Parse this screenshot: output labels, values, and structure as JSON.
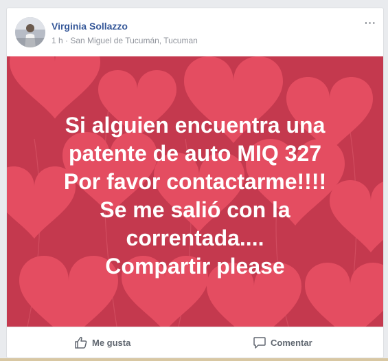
{
  "post": {
    "author": "Virginia Sollazzo",
    "time": "1 h",
    "separator": "·",
    "location": "San Miguel de Tucumán, Tucuman",
    "more_label": "···",
    "text": "Si alguien encuentra una\npatente de auto MIQ 327\nPor favor contactarme!!!!\nSe me salió con la\ncorrentada....\nCompartir please",
    "background_color": "#c83e52",
    "heart_color": "#f0566a"
  },
  "actions": {
    "like_label": "Me gusta",
    "like_icon": "thumbs-up-icon",
    "comment_label": "Comentar",
    "comment_icon": "speech-bubble-icon"
  }
}
